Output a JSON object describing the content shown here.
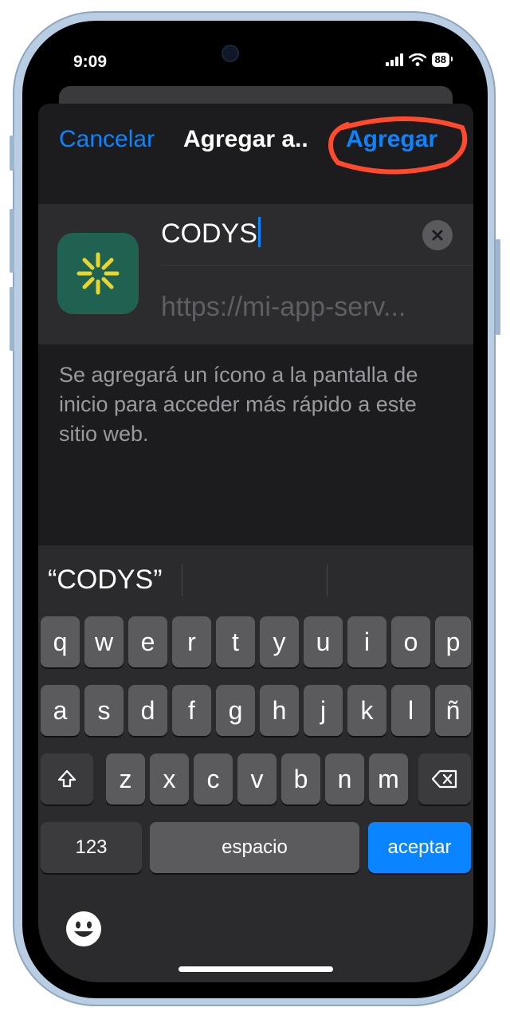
{
  "status": {
    "time": "9:09",
    "battery": "88"
  },
  "nav": {
    "cancel": "Cancelar",
    "title": "Agregar a..",
    "add": "Agregar"
  },
  "bookmark": {
    "name": "CODYS",
    "url": "https://mi-app-serv..."
  },
  "description": "Se agregará un ícono a la pantalla de inicio para acceder más rápido a este sitio web.",
  "keyboard": {
    "suggestion": "“CODYS”",
    "row1": [
      "q",
      "w",
      "e",
      "r",
      "t",
      "y",
      "u",
      "i",
      "o",
      "p"
    ],
    "row2": [
      "a",
      "s",
      "d",
      "f",
      "g",
      "h",
      "j",
      "k",
      "l",
      "ñ"
    ],
    "row3": [
      "z",
      "x",
      "c",
      "v",
      "b",
      "n",
      "m"
    ],
    "numbers": "123",
    "space": "espacio",
    "return": "aceptar"
  },
  "colors": {
    "accent": "#0a84ff",
    "annotation": "#ff4a2e",
    "app_icon_bg": "#1f6252",
    "app_icon_mark": "#e8d62a"
  },
  "icons": {
    "shift": "shift-icon",
    "delete": "backspace-icon",
    "emoji": "emoji-icon",
    "clear": "clear-icon",
    "wifi": "wifi-icon",
    "signal": "signal-icon",
    "battery": "battery-icon"
  }
}
